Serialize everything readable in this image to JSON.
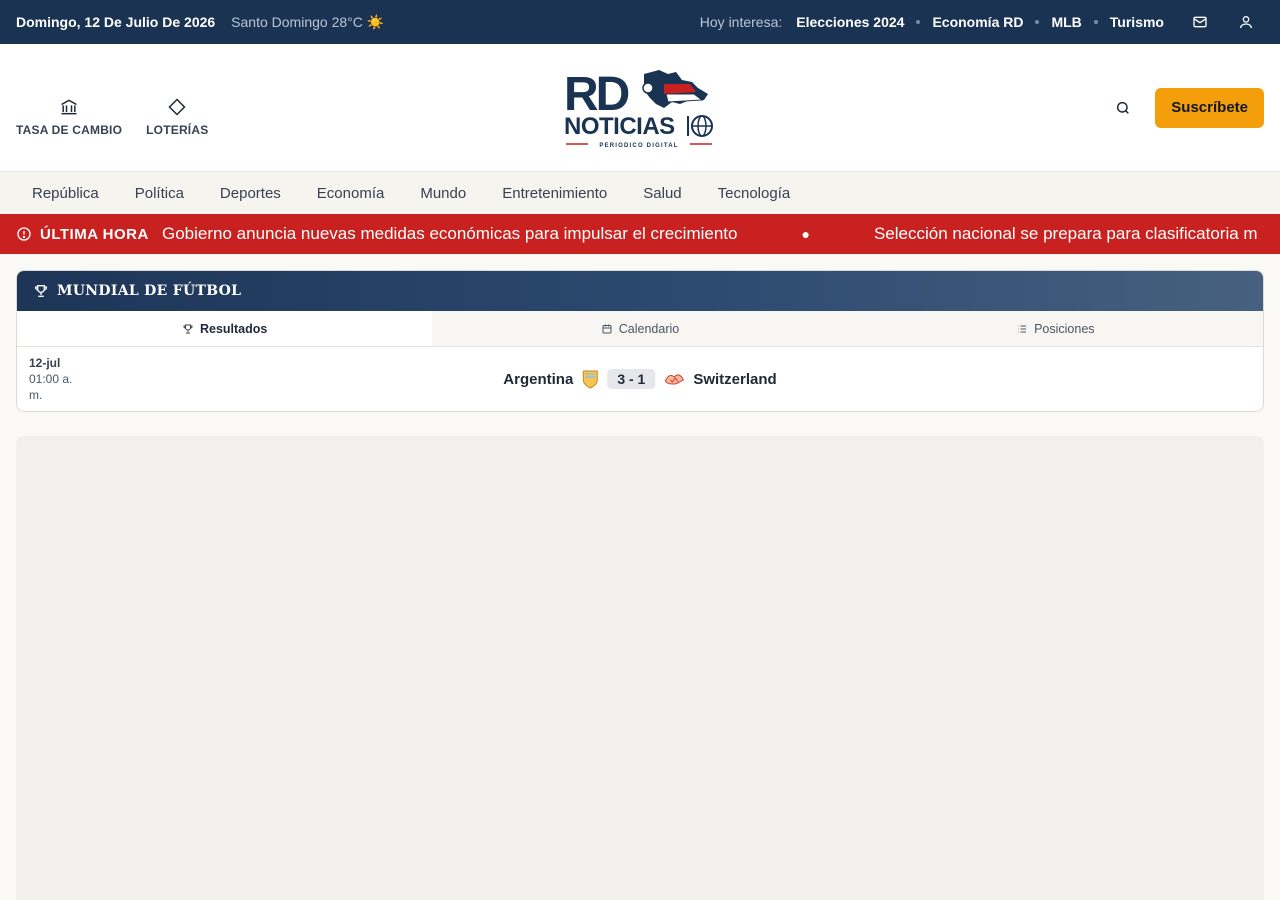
{
  "topbar": {
    "date": "Domingo, 12 De Julio De 2026",
    "weather": "Santo Domingo 28°C",
    "weather_icon": "☀️",
    "trending_label": "Hoy interesa:",
    "trending": [
      "Elecciones 2024",
      "Economía RD",
      "MLB",
      "Turismo"
    ]
  },
  "header": {
    "quick": [
      {
        "label": "TASA DE CAMBIO",
        "icon": "bank-icon"
      },
      {
        "label": "LOTERÍAS",
        "icon": "diamond-icon"
      }
    ],
    "logo": {
      "top": "RD",
      "bottom": "NOTICIAS",
      "tagline": "PERIODICO DIGITAL"
    },
    "subscribe": "Suscríbete"
  },
  "nav": [
    "República",
    "Política",
    "Deportes",
    "Economía",
    "Mundo",
    "Entretenimiento",
    "Salud",
    "Tecnología"
  ],
  "breaking": {
    "label": "ÚLTIMA HORA",
    "items": [
      "Gobierno anuncia nuevas medidas económicas para impulsar el crecimiento",
      "Selección nacional se prepara para clasificatoria m"
    ]
  },
  "widget": {
    "title": "MUNDIAL DE FÚTBOL",
    "tabs": [
      "Resultados",
      "Calendario",
      "Posiciones"
    ],
    "match": {
      "date": "12-jul",
      "time": "01:00 a. m.",
      "home": "Argentina",
      "away": "Switzerland",
      "score": "3 - 1"
    }
  },
  "colors": {
    "topbar": "#1b3353",
    "accent": "#f59e0b",
    "breaking": "#c9211f"
  }
}
